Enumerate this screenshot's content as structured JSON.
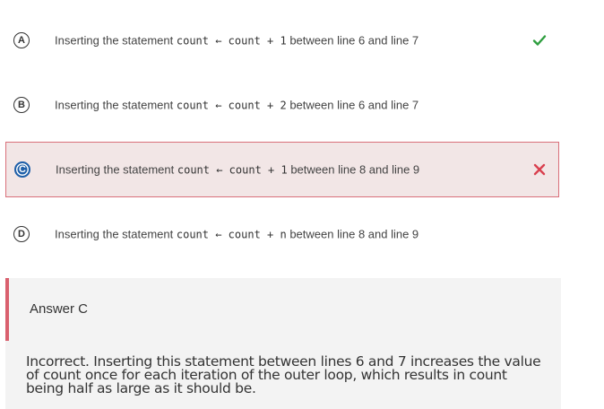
{
  "options": [
    {
      "letter": "A",
      "prefix": "Inserting the statement",
      "code": "count ← count + 1",
      "suffix": "between line 6 and line 7",
      "mark": "correct-check-icon"
    },
    {
      "letter": "B",
      "prefix": "Inserting the statement",
      "code": "count ← count + 2",
      "suffix": "between line 6 and line 7",
      "mark": ""
    },
    {
      "letter": "C",
      "prefix": "Inserting the statement",
      "code": "count ← count + 1",
      "suffix": "between line 8 and line 9",
      "mark": "incorrect-x-icon"
    },
    {
      "letter": "D",
      "prefix": "Inserting the statement",
      "code": "count ← count + n",
      "suffix": "between line 8 and line 9",
      "mark": ""
    }
  ],
  "colors": {
    "correct": "#2e9e3f",
    "incorrect": "#d9404f",
    "selected_badge": "#1f5fa8",
    "feedback_bar": "#d9606e"
  },
  "feedback": {
    "title": "Answer C",
    "body": "Incorrect. Inserting this statement between lines 6 and 7 increases the value of count once for each iteration of the outer loop, which results in count being half as large as it should be."
  }
}
